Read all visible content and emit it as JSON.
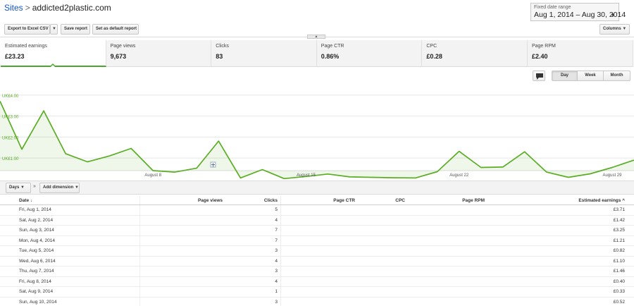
{
  "breadcrumb": {
    "sites_label": "Sites",
    "separator": ">",
    "site": "addicted2plastic.com"
  },
  "date_range": {
    "label": "Fixed date range",
    "value": "Aug 1, 2014 – Aug 30, 2014"
  },
  "toolbar": {
    "export_label": "Export to Excel CSV",
    "save_label": "Save report",
    "default_label": "Set as default report",
    "columns_label": "Columns"
  },
  "scorecards": [
    {
      "label": "Estimated earnings",
      "value": "£23.23"
    },
    {
      "label": "Page views",
      "value": "9,673"
    },
    {
      "label": "Clicks",
      "value": "83"
    },
    {
      "label": "Page CTR",
      "value": "0.86%"
    },
    {
      "label": "CPC",
      "value": "£0.28"
    },
    {
      "label": "Page RPM",
      "value": "£2.40"
    }
  ],
  "granularity": {
    "day": "Day",
    "week": "Week",
    "month": "Month",
    "selected": "Day"
  },
  "chart_data": {
    "type": "area",
    "color": "#5aad24",
    "y_tick_labels": [
      "UK£4.00",
      "UK£3.00",
      "UK£2.00",
      "UK£1.00"
    ],
    "y_ticks": [
      4,
      3,
      2,
      1
    ],
    "ylim": [
      0.4,
      4.3
    ],
    "x_tick_labels": [
      "August 8",
      "August 15",
      "August 22",
      "August 29"
    ],
    "x_ticks": [
      8,
      15,
      22,
      29
    ],
    "xlim": [
      1,
      30
    ],
    "grid": true,
    "x": [
      1,
      2,
      3,
      4,
      5,
      6,
      7,
      8,
      9,
      10,
      11,
      12,
      13,
      14,
      15,
      16,
      17,
      18,
      19,
      20,
      21,
      22,
      23,
      24,
      25,
      26,
      27,
      28,
      29,
      30
    ],
    "values": [
      3.71,
      1.42,
      3.25,
      1.21,
      0.82,
      1.1,
      1.46,
      0.4,
      0.33,
      0.52,
      1.81,
      0.05,
      0.45,
      0.02,
      0.12,
      0.24,
      0.1,
      0.08,
      0.06,
      0.05,
      0.35,
      1.32,
      0.55,
      0.57,
      1.3,
      0.33,
      0.08,
      0.25,
      0.55,
      0.9
    ]
  },
  "dimension_bar": {
    "days_label": "Days",
    "arrow": "»",
    "add_label": "Add dimension"
  },
  "table": {
    "headers": {
      "date": "Date",
      "sort_icon": "↓",
      "page_views": "Page views",
      "clicks": "Clicks",
      "ctr": "Page CTR",
      "cpc": "CPC",
      "rpm": "Page RPM",
      "earnings": "Estimated earnings",
      "earnings_marker": "^"
    },
    "rows": [
      {
        "date": "Fri, Aug 1, 2014",
        "clicks": "5",
        "earnings": "£3.71"
      },
      {
        "date": "Sat, Aug 2, 2014",
        "clicks": "4",
        "earnings": "£1.42"
      },
      {
        "date": "Sun, Aug 3, 2014",
        "clicks": "7",
        "earnings": "£3.25"
      },
      {
        "date": "Mon, Aug 4, 2014",
        "clicks": "7",
        "earnings": "£1.21"
      },
      {
        "date": "Tue, Aug 5, 2014",
        "clicks": "3",
        "earnings": "£0.82"
      },
      {
        "date": "Wed, Aug 6, 2014",
        "clicks": "4",
        "earnings": "£1.10"
      },
      {
        "date": "Thu, Aug 7, 2014",
        "clicks": "3",
        "earnings": "£1.46"
      },
      {
        "date": "Fri, Aug 8, 2014",
        "clicks": "4",
        "earnings": "£0.40"
      },
      {
        "date": "Sat, Aug 9, 2014",
        "clicks": "1",
        "earnings": "£0.33"
      },
      {
        "date": "Sun, Aug 10, 2014",
        "clicks": "3",
        "earnings": "£0.52"
      }
    ]
  }
}
